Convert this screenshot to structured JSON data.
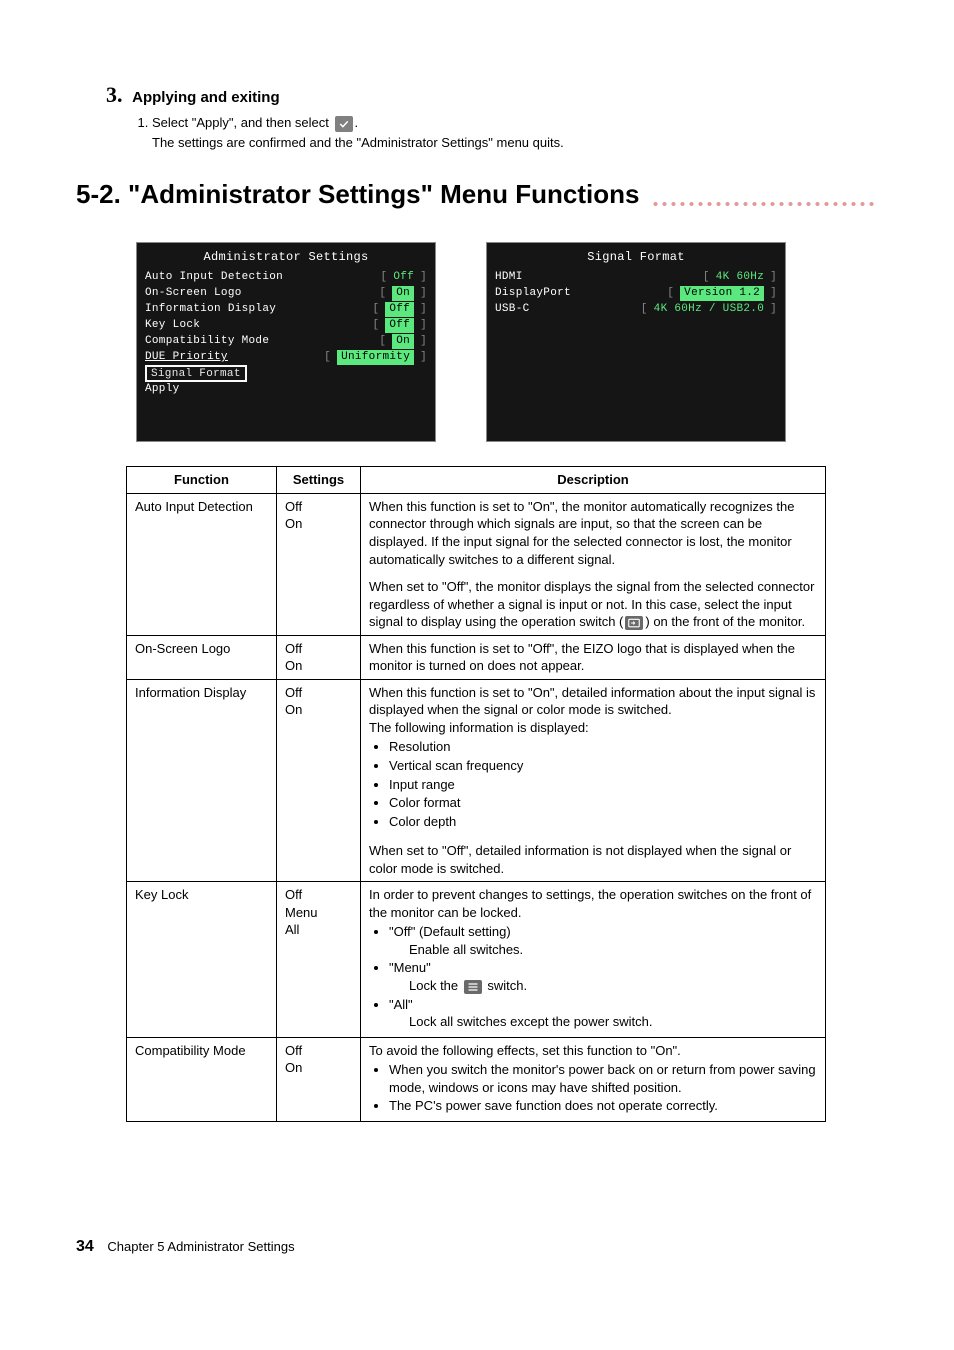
{
  "step": {
    "number": "3.",
    "title": "Applying and exiting",
    "sub_index": "1.",
    "sub_text_a": "Select \"Apply\", and then select ",
    "sub_text_b": ".",
    "sub_desc": "The settings are confirmed and the \"Administrator Settings\" menu quits."
  },
  "section_title": "5-2. \"Administrator Settings\" Menu Functions",
  "osd_left": {
    "title": "Administrator Settings",
    "rows": [
      {
        "label": "Auto Input Detection",
        "value": "Off",
        "hl": false
      },
      {
        "label": "On-Screen Logo",
        "value": "On",
        "hl": true
      },
      {
        "label": "Information Display",
        "value": "Off",
        "hl": true
      },
      {
        "label": "Key Lock",
        "value": "Off",
        "hl": true
      },
      {
        "label": "Compatibility Mode",
        "value": "On",
        "hl": true
      },
      {
        "label": "DUE Priority",
        "value": "Uniformity",
        "hl": true,
        "underline": true
      }
    ],
    "selected": "Signal Format",
    "apply": "Apply"
  },
  "osd_right": {
    "title": "Signal Format",
    "rows": [
      {
        "label": "HDMI",
        "value": "4K 60Hz",
        "hl": false
      },
      {
        "label": "DisplayPort",
        "value": "Version 1.2",
        "hl": true
      },
      {
        "label": "USB-C",
        "value": "4K 60Hz / USB2.0",
        "hl": false
      }
    ]
  },
  "table": {
    "headers": [
      "Function",
      "Settings",
      "Description"
    ],
    "rows": [
      {
        "func": "Auto Input Detection",
        "settings": [
          "Off",
          "On"
        ],
        "desc_p1": "When this function is set to \"On\", the monitor automatically recognizes the connector through which signals are input, so that the screen can be displayed. If the input signal for the selected connector is lost, the monitor automatically switches to a different signal.",
        "desc_p2a": "When set to \"Off\", the monitor displays the signal from the selected connector regardless of whether a signal is input or not. In this case, select the input signal to display using the operation switch (",
        "desc_p2b": ") on the front of the monitor."
      },
      {
        "func": "On-Screen Logo",
        "settings": [
          "Off",
          "On"
        ],
        "desc_p1": "When this function is set to \"Off\", the EIZO logo that is displayed when the monitor is turned on does not appear."
      },
      {
        "func": "Information Display",
        "settings": [
          "Off",
          "On"
        ],
        "desc_p1": "When this function is set to \"On\", detailed information about the input signal is displayed when the signal or color mode is switched.",
        "desc_p2": "The following information is displayed:",
        "bullets": [
          "Resolution",
          "Vertical scan frequency",
          "Input range",
          "Color format",
          "Color depth"
        ],
        "desc_p3": "When set to \"Off\", detailed information is not displayed when the signal or color mode is switched."
      },
      {
        "func": "Key Lock",
        "settings": [
          "Off",
          "Menu",
          "All"
        ],
        "desc_p1": "In order to prevent changes to settings, the operation switches on the front of the monitor can be locked.",
        "items": [
          {
            "label": "\"Off\" (Default setting)",
            "sub": "Enable all switches."
          },
          {
            "label": "\"Menu\"",
            "sub_a": "Lock the ",
            "sub_b": " switch.",
            "icon": "menu"
          },
          {
            "label": "\"All\"",
            "sub": "Lock all switches except the power switch."
          }
        ]
      },
      {
        "func": "Compatibility Mode",
        "settings": [
          "Off",
          "On"
        ],
        "desc_p1": "To avoid the following effects, set this function to \"On\".",
        "bullets": [
          "When you switch the monitor's power back on or return from power saving mode, windows or icons may have shifted position.",
          "The PC's power save function does not operate correctly."
        ]
      }
    ]
  },
  "footer": {
    "page": "34",
    "chapter": "Chapter 5   Administrator Settings"
  }
}
